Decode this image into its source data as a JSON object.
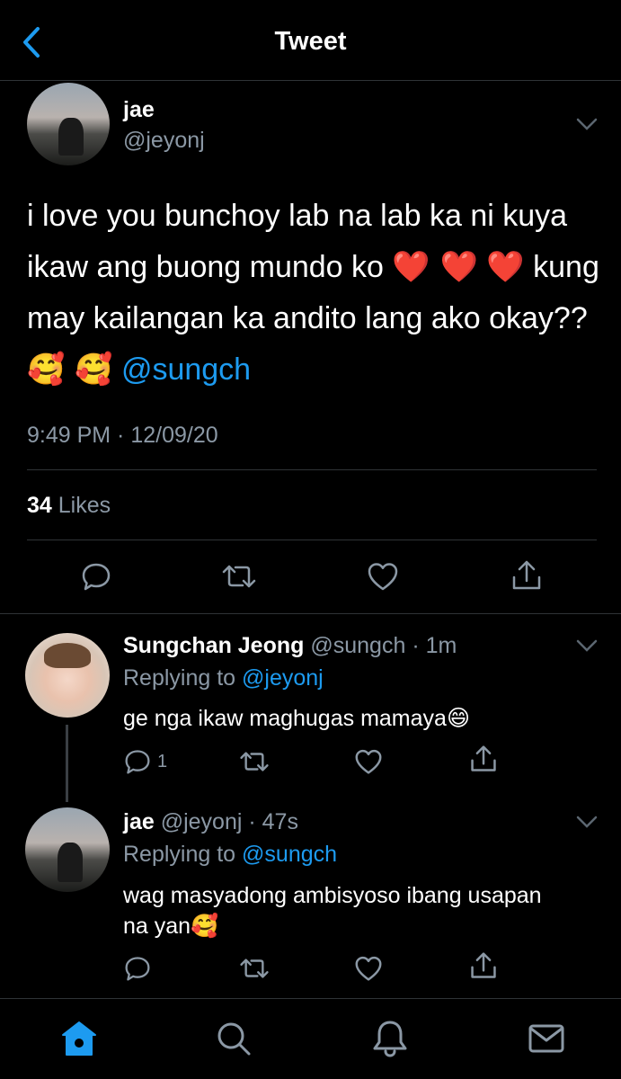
{
  "header": {
    "title": "Tweet",
    "back_icon": "chevron-left-icon"
  },
  "main_tweet": {
    "name": "jae",
    "handle": "@jeyonj",
    "text_parts": [
      "i love you bunchoy lab na lab ka ni kuya ikaw ang buong mundo ko",
      "❤️ ❤️",
      "❤️",
      "kung may kailangan ka andito lang ako okay??",
      "🥰 🥰",
      "@sungch"
    ],
    "timestamp": "9:49 PM · 12/09/20",
    "likes_count": "34",
    "likes_label": "Likes"
  },
  "replies": [
    {
      "name": "Sungchan Jeong",
      "handle": "@sungch",
      "time": "· 1m",
      "replying_prefix": "Replying to",
      "replying_handle": "@jeyonj",
      "text": "ge nga ikaw maghugas mamaya",
      "emoji": "😄",
      "reply_count": "1"
    },
    {
      "name": "jae",
      "handle": "@jeyonj",
      "time": "· 47s",
      "replying_prefix": "Replying to",
      "replying_handle": "@sungch",
      "text_line1": "wag masyadong ambisyoso ibang usapan",
      "text_line2": "na yan",
      "emoji": "🥰"
    }
  ],
  "tabs": [
    "home-icon",
    "search-icon",
    "notifications-bell-icon",
    "messages-envelope-icon"
  ],
  "colors": {
    "background": "#000000",
    "accent": "#1d9bf0",
    "muted": "#8b98a5",
    "divider": "#2f3336"
  }
}
